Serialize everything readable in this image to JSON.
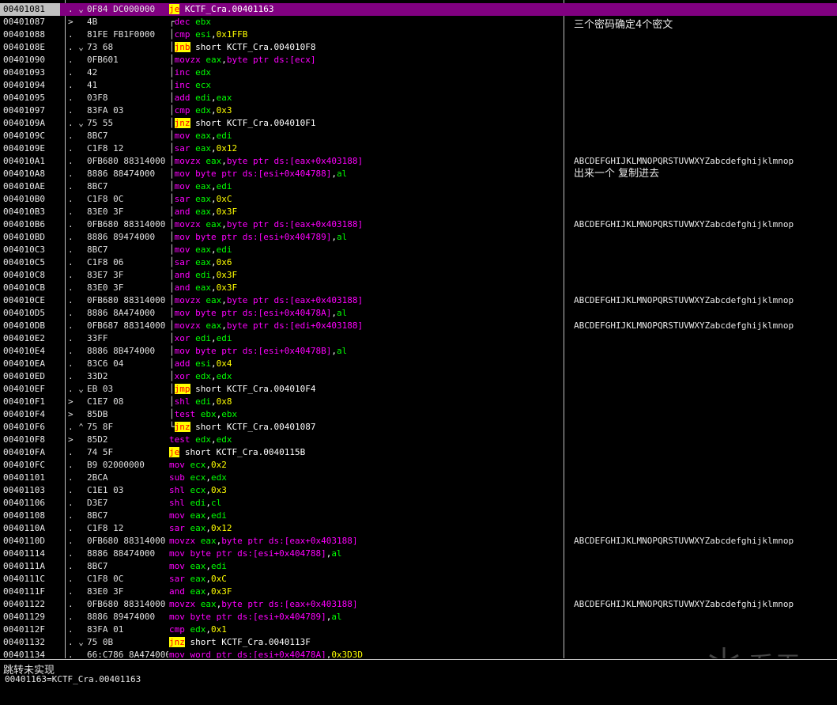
{
  "status": {
    "line1": "跳转未实现",
    "line2": "00401163=KCTF_Cra.00401163"
  },
  "rows": [
    {
      "addr": "00401081",
      "mark": ". ⌄.",
      "hex": "0F84 DC000000",
      "sel": true,
      "dis": [
        [
          "jmp",
          "je"
        ],
        [
          "plain",
          " KCTF_Cra.00401163"
        ]
      ]
    },
    {
      "addr": "00401087",
      "mark": ">",
      "hex": "4B",
      "brk": "┌",
      "dis": [
        [
          "op",
          "dec"
        ],
        [
          "plain",
          " "
        ],
        [
          "reg",
          "ebx"
        ]
      ]
    },
    {
      "addr": "00401088",
      "mark": ".",
      "hex": "81FE FB1F0000",
      "brk": "│",
      "dis": [
        [
          "op",
          "cmp"
        ],
        [
          "plain",
          " "
        ],
        [
          "reg",
          "esi"
        ],
        [
          "plain",
          ","
        ],
        [
          "imm",
          "0x1FFB"
        ]
      ]
    },
    {
      "addr": "0040108E",
      "mark": ". ⌄.",
      "hex": "73 68",
      "brk": "│",
      "dis": [
        [
          "jmp",
          "jnb"
        ],
        [
          "plain",
          " short KCTF_Cra.004010F8"
        ]
      ]
    },
    {
      "addr": "00401090",
      "mark": ".",
      "hex": "0FB601",
      "brk": "│",
      "dis": [
        [
          "op",
          "movzx"
        ],
        [
          "plain",
          " "
        ],
        [
          "reg",
          "eax"
        ],
        [
          "plain",
          ","
        ],
        [
          "mem",
          "byte ptr ds:[ecx]"
        ]
      ]
    },
    {
      "addr": "00401093",
      "mark": ".",
      "hex": "42",
      "brk": "│",
      "dis": [
        [
          "op",
          "inc"
        ],
        [
          "plain",
          " "
        ],
        [
          "reg",
          "edx"
        ]
      ]
    },
    {
      "addr": "00401094",
      "mark": ".",
      "hex": "41",
      "brk": "│",
      "dis": [
        [
          "op",
          "inc"
        ],
        [
          "plain",
          " "
        ],
        [
          "reg",
          "ecx"
        ]
      ]
    },
    {
      "addr": "00401095",
      "mark": ".",
      "hex": "03F8",
      "brk": "│",
      "dis": [
        [
          "op",
          "add"
        ],
        [
          "plain",
          " "
        ],
        [
          "reg",
          "edi"
        ],
        [
          "plain",
          ","
        ],
        [
          "reg",
          "eax"
        ]
      ]
    },
    {
      "addr": "00401097",
      "mark": ".",
      "hex": "83FA 03",
      "brk": "│",
      "dis": [
        [
          "op",
          "cmp"
        ],
        [
          "plain",
          " "
        ],
        [
          "reg",
          "edx"
        ],
        [
          "plain",
          ","
        ],
        [
          "imm",
          "0x3"
        ]
      ]
    },
    {
      "addr": "0040109A",
      "mark": ". ⌄.",
      "hex": "75 55",
      "brk": "│",
      "dis": [
        [
          "jmp",
          "jnz"
        ],
        [
          "plain",
          " short KCTF_Cra.004010F1"
        ]
      ]
    },
    {
      "addr": "0040109C",
      "mark": ".",
      "hex": "8BC7",
      "brk": "│",
      "dis": [
        [
          "op",
          "mov"
        ],
        [
          "plain",
          " "
        ],
        [
          "reg",
          "eax"
        ],
        [
          "plain",
          ","
        ],
        [
          "reg",
          "edi"
        ]
      ]
    },
    {
      "addr": "0040109E",
      "mark": ".",
      "hex": "C1F8 12",
      "brk": "│",
      "dis": [
        [
          "op",
          "sar"
        ],
        [
          "plain",
          " "
        ],
        [
          "reg",
          "eax"
        ],
        [
          "plain",
          ","
        ],
        [
          "imm",
          "0x12"
        ]
      ]
    },
    {
      "addr": "004010A1",
      "mark": ".",
      "hex": "0FB680 88314000",
      "brk": "│",
      "dis": [
        [
          "op",
          "movzx"
        ],
        [
          "plain",
          " "
        ],
        [
          "reg",
          "eax"
        ],
        [
          "plain",
          ","
        ],
        [
          "mem",
          "byte ptr ds:[eax+0x403188]"
        ]
      ],
      "com": "ABCDEFGHIJKLMNOPQRSTUVWXYZabcdefghijklmnop",
      "comMono": true
    },
    {
      "addr": "004010A8",
      "mark": ".",
      "hex": "8886 88474000",
      "brk": "│",
      "dis": [
        [
          "op",
          "mov"
        ],
        [
          "plain",
          " "
        ],
        [
          "mem",
          "byte ptr ds:[esi+0x404788]"
        ],
        [
          "plain",
          ","
        ],
        [
          "reg",
          "al"
        ]
      ],
      "com": "出来一个 复制进去"
    },
    {
      "addr": "004010AE",
      "mark": ".",
      "hex": "8BC7",
      "brk": "│",
      "dis": [
        [
          "op",
          "mov"
        ],
        [
          "plain",
          " "
        ],
        [
          "reg",
          "eax"
        ],
        [
          "plain",
          ","
        ],
        [
          "reg",
          "edi"
        ]
      ]
    },
    {
      "addr": "004010B0",
      "mark": ".",
      "hex": "C1F8 0C",
      "brk": "│",
      "dis": [
        [
          "op",
          "sar"
        ],
        [
          "plain",
          " "
        ],
        [
          "reg",
          "eax"
        ],
        [
          "plain",
          ","
        ],
        [
          "imm",
          "0xC"
        ]
      ]
    },
    {
      "addr": "004010B3",
      "mark": ".",
      "hex": "83E0 3F",
      "brk": "│",
      "dis": [
        [
          "op",
          "and"
        ],
        [
          "plain",
          " "
        ],
        [
          "reg",
          "eax"
        ],
        [
          "plain",
          ","
        ],
        [
          "imm",
          "0x3F"
        ]
      ]
    },
    {
      "addr": "004010B6",
      "mark": ".",
      "hex": "0FB680 88314000",
      "brk": "│",
      "dis": [
        [
          "op",
          "movzx"
        ],
        [
          "plain",
          " "
        ],
        [
          "reg",
          "eax"
        ],
        [
          "plain",
          ","
        ],
        [
          "mem",
          "byte ptr ds:[eax+0x403188]"
        ]
      ],
      "com": "ABCDEFGHIJKLMNOPQRSTUVWXYZabcdefghijklmnop",
      "comMono": true
    },
    {
      "addr": "004010BD",
      "mark": ".",
      "hex": "8886 89474000",
      "brk": "│",
      "dis": [
        [
          "op",
          "mov"
        ],
        [
          "plain",
          " "
        ],
        [
          "mem",
          "byte ptr ds:[esi+0x404789]"
        ],
        [
          "plain",
          ","
        ],
        [
          "reg",
          "al"
        ]
      ]
    },
    {
      "addr": "004010C3",
      "mark": ".",
      "hex": "8BC7",
      "brk": "│",
      "dis": [
        [
          "op",
          "mov"
        ],
        [
          "plain",
          " "
        ],
        [
          "reg",
          "eax"
        ],
        [
          "plain",
          ","
        ],
        [
          "reg",
          "edi"
        ]
      ]
    },
    {
      "addr": "004010C5",
      "mark": ".",
      "hex": "C1F8 06",
      "brk": "│",
      "dis": [
        [
          "op",
          "sar"
        ],
        [
          "plain",
          " "
        ],
        [
          "reg",
          "eax"
        ],
        [
          "plain",
          ","
        ],
        [
          "imm",
          "0x6"
        ]
      ]
    },
    {
      "addr": "004010C8",
      "mark": ".",
      "hex": "83E7 3F",
      "brk": "│",
      "dis": [
        [
          "op",
          "and"
        ],
        [
          "plain",
          " "
        ],
        [
          "reg",
          "edi"
        ],
        [
          "plain",
          ","
        ],
        [
          "imm",
          "0x3F"
        ]
      ]
    },
    {
      "addr": "004010CB",
      "mark": ".",
      "hex": "83E0 3F",
      "brk": "│",
      "dis": [
        [
          "op",
          "and"
        ],
        [
          "plain",
          " "
        ],
        [
          "reg",
          "eax"
        ],
        [
          "plain",
          ","
        ],
        [
          "imm",
          "0x3F"
        ]
      ]
    },
    {
      "addr": "004010CE",
      "mark": ".",
      "hex": "0FB680 88314000",
      "brk": "│",
      "dis": [
        [
          "op",
          "movzx"
        ],
        [
          "plain",
          " "
        ],
        [
          "reg",
          "eax"
        ],
        [
          "plain",
          ","
        ],
        [
          "mem",
          "byte ptr ds:[eax+0x403188]"
        ]
      ],
      "com": "ABCDEFGHIJKLMNOPQRSTUVWXYZabcdefghijklmnop",
      "comMono": true
    },
    {
      "addr": "004010D5",
      "mark": ".",
      "hex": "8886 8A474000",
      "brk": "│",
      "dis": [
        [
          "op",
          "mov"
        ],
        [
          "plain",
          " "
        ],
        [
          "mem",
          "byte ptr ds:[esi+0x40478A]"
        ],
        [
          "plain",
          ","
        ],
        [
          "reg",
          "al"
        ]
      ]
    },
    {
      "addr": "004010DB",
      "mark": ".",
      "hex": "0FB687 88314000",
      "brk": "│",
      "dis": [
        [
          "op",
          "movzx"
        ],
        [
          "plain",
          " "
        ],
        [
          "reg",
          "eax"
        ],
        [
          "plain",
          ","
        ],
        [
          "mem",
          "byte ptr ds:[edi+0x403188]"
        ]
      ],
      "com": "ABCDEFGHIJKLMNOPQRSTUVWXYZabcdefghijklmnop",
      "comMono": true
    },
    {
      "addr": "004010E2",
      "mark": ".",
      "hex": "33FF",
      "brk": "│",
      "dis": [
        [
          "op",
          "xor"
        ],
        [
          "plain",
          " "
        ],
        [
          "reg",
          "edi"
        ],
        [
          "plain",
          ","
        ],
        [
          "reg",
          "edi"
        ]
      ]
    },
    {
      "addr": "004010E4",
      "mark": ".",
      "hex": "8886 8B474000",
      "brk": "│",
      "dis": [
        [
          "op",
          "mov"
        ],
        [
          "plain",
          " "
        ],
        [
          "mem",
          "byte ptr ds:[esi+0x40478B]"
        ],
        [
          "plain",
          ","
        ],
        [
          "reg",
          "al"
        ]
      ]
    },
    {
      "addr": "004010EA",
      "mark": ".",
      "hex": "83C6 04",
      "brk": "│",
      "dis": [
        [
          "op",
          "add"
        ],
        [
          "plain",
          " "
        ],
        [
          "reg",
          "esi"
        ],
        [
          "plain",
          ","
        ],
        [
          "imm",
          "0x4"
        ]
      ]
    },
    {
      "addr": "004010ED",
      "mark": ".",
      "hex": "33D2",
      "brk": "│",
      "dis": [
        [
          "op",
          "xor"
        ],
        [
          "plain",
          " "
        ],
        [
          "reg",
          "edx"
        ],
        [
          "plain",
          ","
        ],
        [
          "reg",
          "edx"
        ]
      ]
    },
    {
      "addr": "004010EF",
      "mark": ". ⌄.",
      "hex": "EB 03",
      "brk": "│",
      "dis": [
        [
          "jmp",
          "jmp"
        ],
        [
          "plain",
          " short KCTF_Cra.004010F4"
        ]
      ]
    },
    {
      "addr": "004010F1",
      "mark": ">",
      "hex": "C1E7 08",
      "brk": "│",
      "dis": [
        [
          "op",
          "shl"
        ],
        [
          "plain",
          " "
        ],
        [
          "reg",
          "edi"
        ],
        [
          "plain",
          ","
        ],
        [
          "imm",
          "0x8"
        ]
      ]
    },
    {
      "addr": "004010F4",
      "mark": ">",
      "hex": "85DB",
      "brk": "│",
      "dis": [
        [
          "op",
          "test"
        ],
        [
          "plain",
          " "
        ],
        [
          "reg",
          "ebx"
        ],
        [
          "plain",
          ","
        ],
        [
          "reg",
          "ebx"
        ]
      ]
    },
    {
      "addr": "004010F6",
      "mark": ". ⌃.",
      "hex": "75 8F",
      "brk": "└",
      "dis": [
        [
          "jmp",
          "jnz"
        ],
        [
          "plain",
          " short KCTF_Cra.00401087"
        ]
      ]
    },
    {
      "addr": "004010F8",
      "mark": ">",
      "hex": "85D2",
      "dis": [
        [
          "op",
          "test"
        ],
        [
          "plain",
          " "
        ],
        [
          "reg",
          "edx"
        ],
        [
          "plain",
          ","
        ],
        [
          "reg",
          "edx"
        ]
      ]
    },
    {
      "addr": "004010FA",
      "mark": ".",
      "hex": "74 5F",
      "dis": [
        [
          "jmp",
          "je"
        ],
        [
          "plain",
          " short KCTF_Cra.0040115B"
        ]
      ]
    },
    {
      "addr": "004010FC",
      "mark": ".",
      "hex": "B9 02000000",
      "dis": [
        [
          "op",
          "mov"
        ],
        [
          "plain",
          " "
        ],
        [
          "reg",
          "ecx"
        ],
        [
          "plain",
          ","
        ],
        [
          "imm",
          "0x2"
        ]
      ]
    },
    {
      "addr": "00401101",
      "mark": ".",
      "hex": "2BCA",
      "dis": [
        [
          "op",
          "sub"
        ],
        [
          "plain",
          " "
        ],
        [
          "reg",
          "ecx"
        ],
        [
          "plain",
          ","
        ],
        [
          "reg",
          "edx"
        ]
      ]
    },
    {
      "addr": "00401103",
      "mark": ".",
      "hex": "C1E1 03",
      "dis": [
        [
          "op",
          "shl"
        ],
        [
          "plain",
          " "
        ],
        [
          "reg",
          "ecx"
        ],
        [
          "plain",
          ","
        ],
        [
          "imm",
          "0x3"
        ]
      ]
    },
    {
      "addr": "00401106",
      "mark": ".",
      "hex": "D3E7",
      "dis": [
        [
          "op",
          "shl"
        ],
        [
          "plain",
          " "
        ],
        [
          "reg",
          "edi"
        ],
        [
          "plain",
          ","
        ],
        [
          "reg",
          "cl"
        ]
      ]
    },
    {
      "addr": "00401108",
      "mark": ".",
      "hex": "8BC7",
      "dis": [
        [
          "op",
          "mov"
        ],
        [
          "plain",
          " "
        ],
        [
          "reg",
          "eax"
        ],
        [
          "plain",
          ","
        ],
        [
          "reg",
          "edi"
        ]
      ]
    },
    {
      "addr": "0040110A",
      "mark": ".",
      "hex": "C1F8 12",
      "dis": [
        [
          "op",
          "sar"
        ],
        [
          "plain",
          " "
        ],
        [
          "reg",
          "eax"
        ],
        [
          "plain",
          ","
        ],
        [
          "imm",
          "0x12"
        ]
      ]
    },
    {
      "addr": "0040110D",
      "mark": ".",
      "hex": "0FB680 88314000",
      "dis": [
        [
          "op",
          "movzx"
        ],
        [
          "plain",
          " "
        ],
        [
          "reg",
          "eax"
        ],
        [
          "plain",
          ","
        ],
        [
          "mem",
          "byte ptr ds:[eax+0x403188]"
        ]
      ],
      "com": "ABCDEFGHIJKLMNOPQRSTUVWXYZabcdefghijklmnop",
      "comMono": true
    },
    {
      "addr": "00401114",
      "mark": ".",
      "hex": "8886 88474000",
      "dis": [
        [
          "op",
          "mov"
        ],
        [
          "plain",
          " "
        ],
        [
          "mem",
          "byte ptr ds:[esi+0x404788]"
        ],
        [
          "plain",
          ","
        ],
        [
          "reg",
          "al"
        ]
      ]
    },
    {
      "addr": "0040111A",
      "mark": ".",
      "hex": "8BC7",
      "dis": [
        [
          "op",
          "mov"
        ],
        [
          "plain",
          " "
        ],
        [
          "reg",
          "eax"
        ],
        [
          "plain",
          ","
        ],
        [
          "reg",
          "edi"
        ]
      ]
    },
    {
      "addr": "0040111C",
      "mark": ".",
      "hex": "C1F8 0C",
      "dis": [
        [
          "op",
          "sar"
        ],
        [
          "plain",
          " "
        ],
        [
          "reg",
          "eax"
        ],
        [
          "plain",
          ","
        ],
        [
          "imm",
          "0xC"
        ]
      ]
    },
    {
      "addr": "0040111F",
      "mark": ".",
      "hex": "83E0 3F",
      "dis": [
        [
          "op",
          "and"
        ],
        [
          "plain",
          " "
        ],
        [
          "reg",
          "eax"
        ],
        [
          "plain",
          ","
        ],
        [
          "imm",
          "0x3F"
        ]
      ]
    },
    {
      "addr": "00401122",
      "mark": ".",
      "hex": "0FB680 88314000",
      "dis": [
        [
          "op",
          "movzx"
        ],
        [
          "plain",
          " "
        ],
        [
          "reg",
          "eax"
        ],
        [
          "plain",
          ","
        ],
        [
          "mem",
          "byte ptr ds:[eax+0x403188]"
        ]
      ],
      "com": "ABCDEFGHIJKLMNOPQRSTUVWXYZabcdefghijklmnop",
      "comMono": true
    },
    {
      "addr": "00401129",
      "mark": ".",
      "hex": "8886 89474000",
      "dis": [
        [
          "op",
          "mov"
        ],
        [
          "plain",
          " "
        ],
        [
          "mem",
          "byte ptr ds:[esi+0x404789]"
        ],
        [
          "plain",
          ","
        ],
        [
          "reg",
          "al"
        ]
      ]
    },
    {
      "addr": "0040112F",
      "mark": ".",
      "hex": "83FA 01",
      "dis": [
        [
          "op",
          "cmp"
        ],
        [
          "plain",
          " "
        ],
        [
          "reg",
          "edx"
        ],
        [
          "plain",
          ","
        ],
        [
          "imm",
          "0x1"
        ]
      ]
    },
    {
      "addr": "00401132",
      "mark": ". ⌄.",
      "hex": "75 0B",
      "dis": [
        [
          "jmp",
          "jnz"
        ],
        [
          "plain",
          " short KCTF_Cra.0040113F"
        ]
      ]
    },
    {
      "addr": "00401134",
      "mark": ".",
      "hex": "66:C786 8A474000",
      "dis": [
        [
          "op",
          "mov"
        ],
        [
          "plain",
          " "
        ],
        [
          "mem",
          "word ptr ds:[esi+0x40478A]"
        ],
        [
          "plain",
          ","
        ],
        [
          "imm",
          "0x3D3D"
        ]
      ]
    }
  ],
  "topComment": "三个密码确定4个密文",
  "logo": {
    "text": "看雪"
  }
}
